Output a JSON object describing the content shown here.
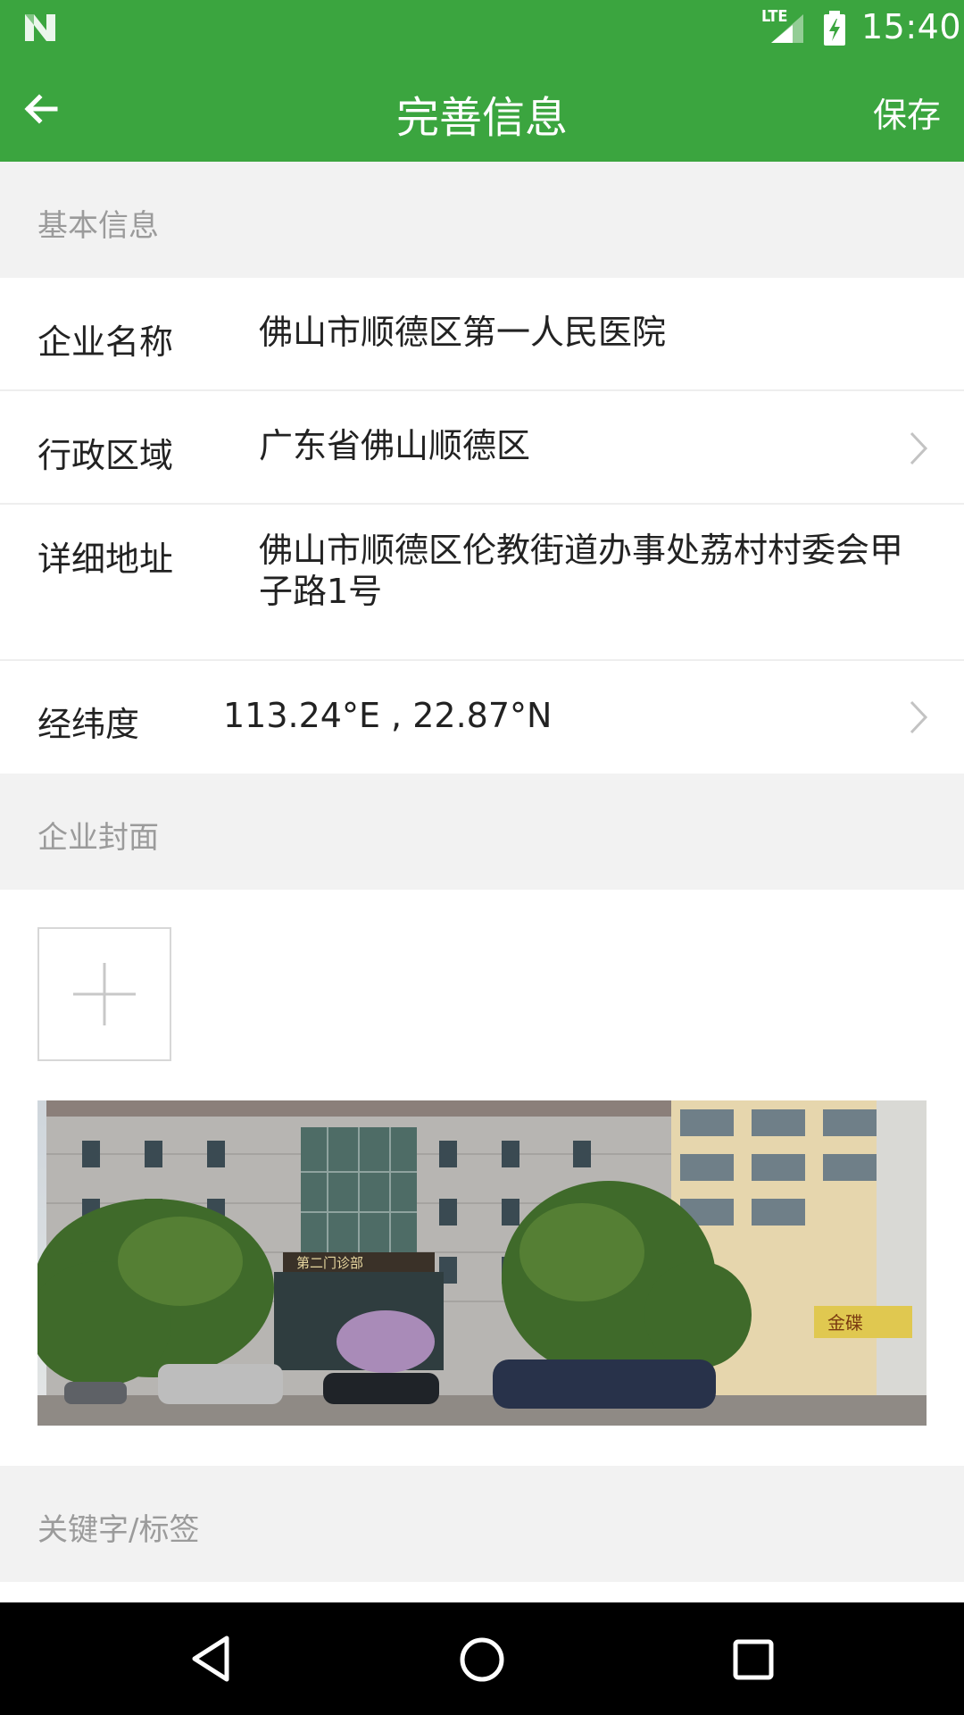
{
  "status_bar": {
    "time": "15:40",
    "network": "LTE",
    "icons": [
      "n-logo-icon",
      "signal-icon",
      "battery-charging-icon"
    ]
  },
  "app_bar": {
    "title": "完善信息",
    "save_label": "保存",
    "back_icon": "arrow-left-icon",
    "color": "#3ba53f"
  },
  "sections": {
    "basic_info_title": "基本信息",
    "cover_title": "企业封面",
    "keywords_title": "关键字/标签"
  },
  "fields": {
    "company_name": {
      "label": "企业名称",
      "value": "佛山市顺德区第一人民医院"
    },
    "region": {
      "label": "行政区域",
      "value": "广东省佛山顺德区"
    },
    "address": {
      "label": "详细地址",
      "value": "佛山市顺德区伦教街道办事处荔村村委会甲子路1号"
    },
    "coordinates": {
      "label": "经纬度",
      "value": "113.24°E , 22.87°N"
    }
  },
  "cover": {
    "add_icon": "plus-icon",
    "photo_signs": [
      "第二门诊部",
      "金碟"
    ]
  },
  "nav_bar": {
    "icons": [
      "back-triangle-icon",
      "home-circle-icon",
      "recents-square-icon"
    ]
  }
}
